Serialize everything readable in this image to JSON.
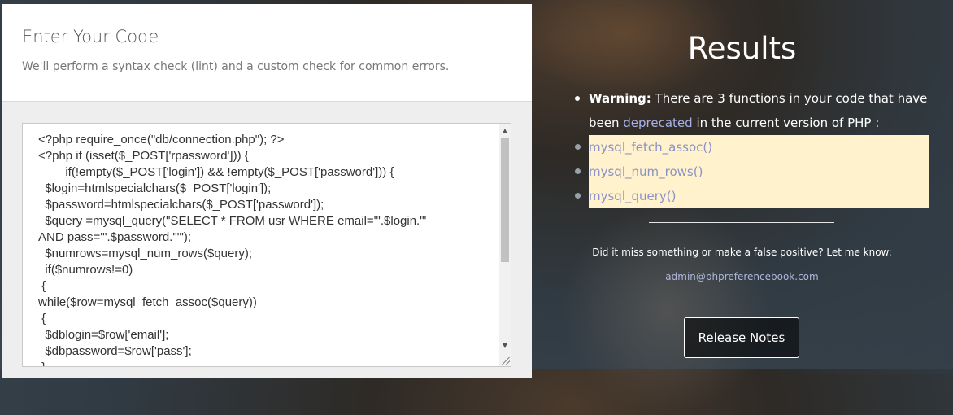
{
  "editor": {
    "title": "Enter Your Code",
    "subtitle": "We'll perform a syntax check (lint) and a custom check for common errors.",
    "code": "<?php require_once(\"db/connection.php\"); ?>\n<?php if (isset($_POST['rpassword'])) {\n\tif(!empty($_POST['login']) && !empty($_POST['password'])) {\n  $login=htmlspecialchars($_POST['login']);\n  $password=htmlspecialchars($_POST['password']);\n  $query =mysql_query(\"SELECT * FROM usr WHERE email='\".$login.\"'\nAND pass='\".$password.\"'\");\n  $numrows=mysql_num_rows($query);\n  if($numrows!=0)\n {\nwhile($row=mysql_fetch_assoc($query))\n {\n  $dblogin=$row['email'];\n  $dbpassword=$row['pass'];\n }"
  },
  "results": {
    "title": "Results",
    "warning_label": "Warning:",
    "warning_text_1": " There are 3 functions in your code that have been ",
    "deprecated_link": "deprecated",
    "warning_text_2": " in the current version of PHP :",
    "functions": [
      "mysql_fetch_assoc()",
      "mysql_num_rows()",
      "mysql_query()"
    ],
    "missed_text": "Did it miss something or make a false positive? Let me know:",
    "email": "admin@phpreferencebook.com",
    "release_notes_label": "Release Notes"
  },
  "colors": {
    "highlight": "#fff2cc",
    "link": "#a7b1e6"
  }
}
